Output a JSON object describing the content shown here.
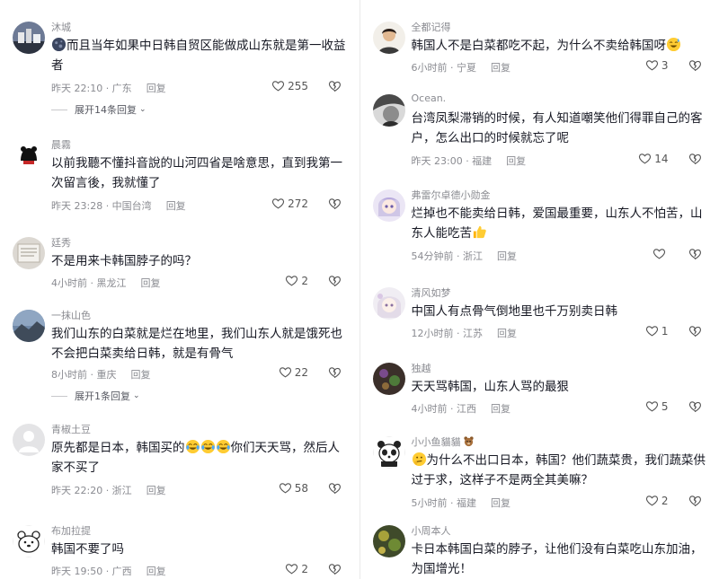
{
  "left_column": {
    "comments": [
      {
        "username": "沐城",
        "body": "而且当年如果中日韩自贸区能做成山东就是第一收益者",
        "body_emoji": "moon-emoji",
        "time": "昨天 22:10 · 广东",
        "reply_label": "回复",
        "likes": "255",
        "expand_label": "展开14条回复"
      },
      {
        "username": "晨霧",
        "body": "以前我聽不懂抖音說的山河四省是啥意思，直到我第一次留言後，我就懂了",
        "time": "昨天 23:28 · 中国台湾",
        "reply_label": "回复",
        "likes": "272"
      },
      {
        "username": "廷秀",
        "body": "不是用来卡韩国脖子的吗？",
        "time": "4小时前 · 黑龙江",
        "reply_label": "回复",
        "likes": "2"
      },
      {
        "username": "一抹山色",
        "body": "我们山东的白菜就是烂在地里，我们山东人就是饿死也不会把白菜卖给日韩，就是有骨气",
        "time": "8小时前 · 重庆",
        "reply_label": "回复",
        "likes": "22",
        "expand_label": "展开1条回复"
      },
      {
        "username": "青椒土豆",
        "body_before": "原先都是日本，韩国买的",
        "body_after": "你们天天骂，然后人家不买了",
        "time": "昨天 22:20 · 浙江",
        "reply_label": "回复",
        "likes": "58"
      },
      {
        "username": "布加拉提",
        "body": "韩国不要了吗",
        "time": "昨天 19:50 · 广西",
        "reply_label": "回复",
        "likes": "2"
      }
    ]
  },
  "right_column": {
    "comments": [
      {
        "username": "全都记得",
        "body": "韩国人不是白菜都吃不起，为什么不卖给韩国呀",
        "time": "6小时前 · 宁夏",
        "reply_label": "回复",
        "likes": "3"
      },
      {
        "username": "Ocean.",
        "body": "台湾凤梨滞销的时候，有人知道嘲笑他们得罪自己的客户，怎么出口的时候就忘了呢",
        "time": "昨天 23:00 · 福建",
        "reply_label": "回复",
        "likes": "14"
      },
      {
        "username": "弗雷尔卓德小勋金",
        "body": "烂掉也不能卖给日韩，爱国最重要，山东人不怕苦，山东人能吃苦",
        "time": "54分钟前 · 浙江",
        "reply_label": "回复",
        "likes": ""
      },
      {
        "username": "清风如梦",
        "body": "中国人有点骨气倒地里也千万别卖日韩",
        "time": "12小时前 · 江苏",
        "reply_label": "回复",
        "likes": "1"
      },
      {
        "username": "独越",
        "body": "天天骂韩国，山东人骂的最狠",
        "time": "4小时前 · 江西",
        "reply_label": "回复",
        "likes": "5"
      },
      {
        "username": "小小鱼貓貓",
        "body": "为什么不出口日本，韩国？他们蔬菜贵，我们蔬菜供过于求，这样子不是两全其美嘛？",
        "time": "5小时前 · 福建",
        "reply_label": "回复",
        "likes": "2"
      },
      {
        "username": "小周本人",
        "body": "卡日本韩国白菜的脖子，让他们没有白菜吃山东加油，为国增光！"
      }
    ]
  },
  "colors": {
    "text": "#161823",
    "meta": "#8a8b91",
    "icon": "#555555"
  }
}
